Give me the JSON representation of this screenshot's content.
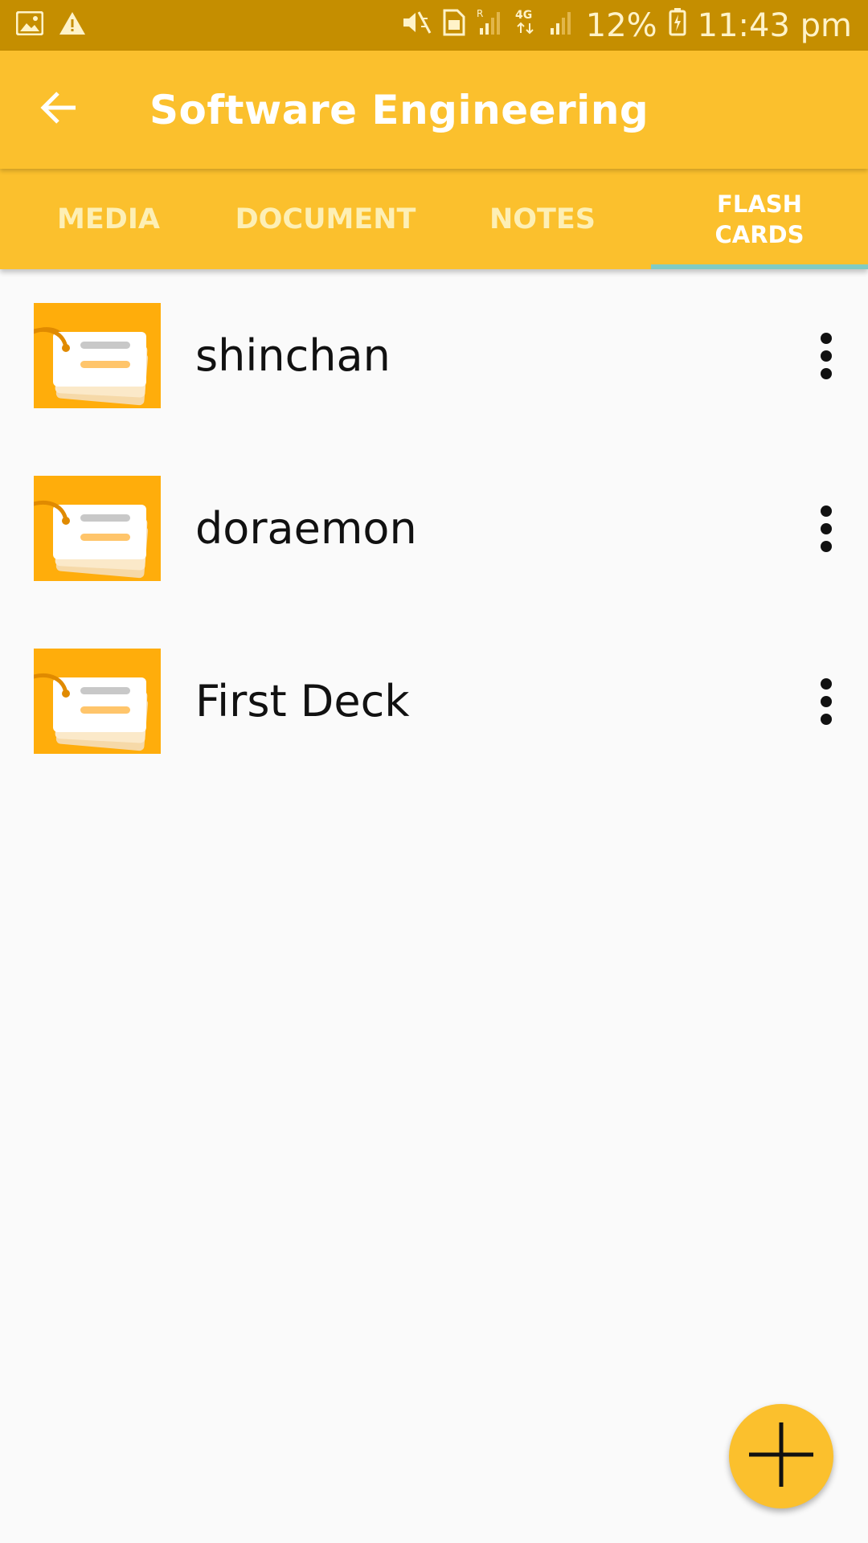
{
  "status_bar": {
    "battery_percent": "12%",
    "time": "11:43 pm",
    "icons": [
      "gallery-icon",
      "warning-icon",
      "mute-icon",
      "sim-icon",
      "signal-r-icon",
      "network-4g-icon",
      "signal-icon",
      "battery-icon"
    ]
  },
  "toolbar": {
    "title": "Software Engineering",
    "back_icon": "arrow-back-icon"
  },
  "tabs": [
    {
      "label": "MEDIA",
      "active": false
    },
    {
      "label": "DOCUMENT",
      "active": false
    },
    {
      "label": "NOTES",
      "active": false
    },
    {
      "label": "FLASH\nCARDS",
      "active": true
    }
  ],
  "decks": [
    {
      "name": "shinchan"
    },
    {
      "name": "doraemon"
    },
    {
      "name": "First Deck"
    }
  ],
  "fab": {
    "icon": "add-icon"
  },
  "colors": {
    "status_bar": "#c58e00",
    "primary": "#fbc02d",
    "tab_indicator": "#80cbc4",
    "deck_icon_bg": "#ffad0b"
  }
}
